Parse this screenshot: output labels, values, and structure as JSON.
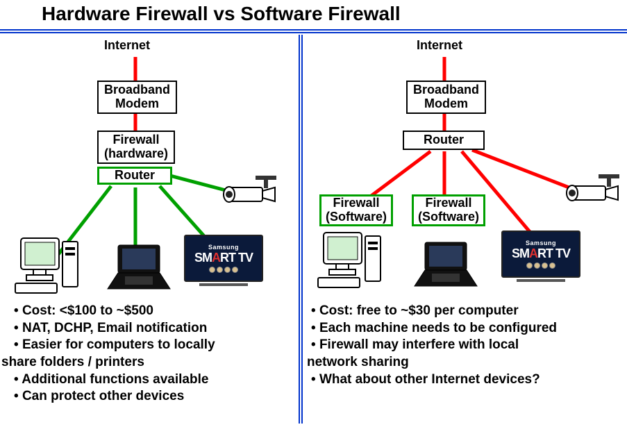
{
  "title": "Hardware Firewall  vs Software Firewall",
  "left": {
    "nodes": {
      "internet": "Internet",
      "modem_l1": "Broadband",
      "modem_l2": "Modem",
      "firewall_l1": "Firewall",
      "firewall_l2": "(hardware)",
      "router": "Router"
    },
    "bullets": [
      "Cost:  <$100 to ~$500",
      "NAT, DCHP, Email notification",
      "Easier for computers  to locally",
      "share folders / printers",
      "Additional functions available",
      "Can protect other devices"
    ],
    "smarttv_brand": "Samsung",
    "smarttv_text": "SMART TV"
  },
  "right": {
    "nodes": {
      "internet": "Internet",
      "modem_l1": "Broadband",
      "modem_l2": "Modem",
      "router": "Router",
      "fw1_l1": "Firewall",
      "fw1_l2": "(Software)",
      "fw2_l1": "Firewall",
      "fw2_l2": "(Software)"
    },
    "bullets": [
      "Cost: free to ~$30 per computer",
      "Each machine  needs to be configured",
      "Firewall may interfere  with local",
      "network sharing",
      "What about other Internet devices?"
    ],
    "smarttv_brand": "Samsung",
    "smarttv_text": "SMART TV"
  },
  "colors": {
    "green": "#00a000",
    "red": "#ff0000",
    "blue": "#0033cc"
  }
}
